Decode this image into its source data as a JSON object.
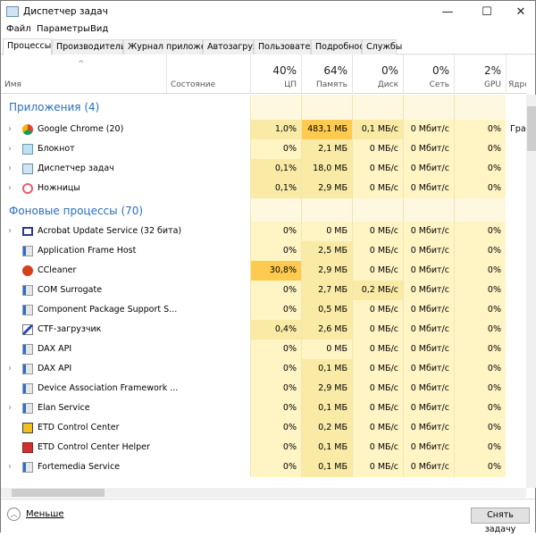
{
  "window": {
    "title": "Диспетчер задач",
    "minimize": "—",
    "maximize": "☐",
    "close": "✕"
  },
  "menu": [
    "Файл",
    "Параметры",
    "Вид"
  ],
  "tabs": [
    "Процессы",
    "Производительность",
    "Журнал приложений",
    "Автозагрузка",
    "Пользователи",
    "Подробности",
    "Службы"
  ],
  "columns": {
    "name": "Имя",
    "state": "Состояние",
    "cpu": {
      "pct": "40%",
      "label": "ЦП"
    },
    "mem": {
      "pct": "64%",
      "label": "Память"
    },
    "disk": {
      "pct": "0%",
      "label": "Диск"
    },
    "net": {
      "pct": "0%",
      "label": "Сеть"
    },
    "gpu": {
      "pct": "2%",
      "label": "GPU"
    },
    "gpu_engine": "Ядро GPU"
  },
  "colors": {
    "heat0": "#fff4c4",
    "heat1": "#f9eba6",
    "heat2": "#ffca50",
    "group": "#2a6fbe"
  },
  "groups": [
    {
      "title": "Приложения (4)",
      "rows": [
        {
          "name": "Google Chrome (20)",
          "icon": "chrome",
          "exp": true,
          "cpu": "1,0%",
          "mem": "483,1 МБ",
          "disk": "0,1 МБ/с",
          "net": "0 Мбит/с",
          "gpu": "0%",
          "engine": "Гра",
          "heat": [
            1,
            2,
            1,
            0,
            0
          ]
        },
        {
          "name": "Блокнот",
          "icon": "notepad",
          "exp": true,
          "cpu": "0%",
          "mem": "2,1 МБ",
          "disk": "0 МБ/с",
          "net": "0 Мбит/с",
          "gpu": "0%",
          "heat": [
            0,
            1,
            0,
            0,
            0
          ]
        },
        {
          "name": "Диспетчер задач",
          "icon": "taskmgr",
          "exp": true,
          "cpu": "0,1%",
          "mem": "18,0 МБ",
          "disk": "0 МБ/с",
          "net": "0 Мбит/с",
          "gpu": "0%",
          "heat": [
            1,
            1,
            0,
            0,
            0
          ]
        },
        {
          "name": "Ножницы",
          "icon": "snipping",
          "exp": true,
          "cpu": "0,1%",
          "mem": "2,9 МБ",
          "disk": "0 МБ/с",
          "net": "0 Мбит/с",
          "gpu": "0%",
          "heat": [
            1,
            1,
            0,
            0,
            0
          ]
        }
      ]
    },
    {
      "title": "Фоновые процессы (70)",
      "rows": [
        {
          "name": "Acrobat Update Service (32 бита)",
          "icon": "window",
          "exp": true,
          "cpu": "0%",
          "mem": "0 МБ",
          "disk": "0 МБ/с",
          "net": "0 Мбит/с",
          "gpu": "0%",
          "heat": [
            0,
            0,
            0,
            0,
            0
          ]
        },
        {
          "name": "Application Frame Host",
          "icon": "service",
          "exp": false,
          "cpu": "0%",
          "mem": "2,5 МБ",
          "disk": "0 МБ/с",
          "net": "0 Мбит/с",
          "gpu": "0%",
          "heat": [
            0,
            1,
            0,
            0,
            0
          ]
        },
        {
          "name": "CCleaner",
          "icon": "ccleaner",
          "exp": false,
          "cpu": "30,8%",
          "mem": "2,9 МБ",
          "disk": "0 МБ/с",
          "net": "0 Мбит/с",
          "gpu": "0%",
          "heat": [
            2,
            1,
            0,
            0,
            0
          ]
        },
        {
          "name": "COM Surrogate",
          "icon": "service",
          "exp": false,
          "cpu": "0%",
          "mem": "2,7 МБ",
          "disk": "0,2 МБ/с",
          "net": "0 Мбит/с",
          "gpu": "0%",
          "heat": [
            0,
            1,
            1,
            0,
            0
          ]
        },
        {
          "name": "Component Package Support S...",
          "icon": "service",
          "exp": false,
          "cpu": "0%",
          "mem": "0,5 МБ",
          "disk": "0 МБ/с",
          "net": "0 Мбит/с",
          "gpu": "0%",
          "heat": [
            0,
            1,
            0,
            0,
            0
          ]
        },
        {
          "name": "CTF-загрузчик",
          "icon": "ctf",
          "exp": false,
          "cpu": "0,4%",
          "mem": "2,6 МБ",
          "disk": "0 МБ/с",
          "net": "0 Мбит/с",
          "gpu": "0%",
          "heat": [
            1,
            1,
            0,
            0,
            0
          ]
        },
        {
          "name": "DAX API",
          "icon": "service",
          "exp": false,
          "cpu": "0%",
          "mem": "0 МБ",
          "disk": "0 МБ/с",
          "net": "0 Мбит/с",
          "gpu": "0%",
          "heat": [
            0,
            0,
            0,
            0,
            0
          ]
        },
        {
          "name": "DAX API",
          "icon": "service",
          "exp": true,
          "cpu": "0%",
          "mem": "0,1 МБ",
          "disk": "0 МБ/с",
          "net": "0 Мбит/с",
          "gpu": "0%",
          "heat": [
            0,
            1,
            0,
            0,
            0
          ]
        },
        {
          "name": "Device Association Framework ...",
          "icon": "service",
          "exp": false,
          "cpu": "0%",
          "mem": "2,9 МБ",
          "disk": "0 МБ/с",
          "net": "0 Мбит/с",
          "gpu": "0%",
          "heat": [
            0,
            1,
            0,
            0,
            0
          ]
        },
        {
          "name": "Elan Service",
          "icon": "service",
          "exp": true,
          "cpu": "0%",
          "mem": "0,1 МБ",
          "disk": "0 МБ/с",
          "net": "0 Мбит/с",
          "gpu": "0%",
          "heat": [
            0,
            1,
            0,
            0,
            0
          ]
        },
        {
          "name": "ETD Control Center",
          "icon": "etd",
          "exp": false,
          "cpu": "0%",
          "mem": "0,2 МБ",
          "disk": "0 МБ/с",
          "net": "0 Мбит/с",
          "gpu": "0%",
          "heat": [
            0,
            1,
            0,
            0,
            0
          ]
        },
        {
          "name": "ETD Control Center Helper",
          "icon": "etdhelper",
          "exp": false,
          "cpu": "0%",
          "mem": "0,1 МБ",
          "disk": "0 МБ/с",
          "net": "0 Мбит/с",
          "gpu": "0%",
          "heat": [
            0,
            1,
            0,
            0,
            0
          ]
        },
        {
          "name": "Fortemedia Service",
          "icon": "service",
          "exp": true,
          "cpu": "0%",
          "mem": "0,1 МБ",
          "disk": "0 МБ/с",
          "net": "0 Мбит/с",
          "gpu": "0%",
          "heat": [
            0,
            1,
            0,
            0,
            0
          ]
        }
      ]
    }
  ],
  "footer": {
    "less": "Меньше",
    "end_task": "Снять задачу"
  }
}
